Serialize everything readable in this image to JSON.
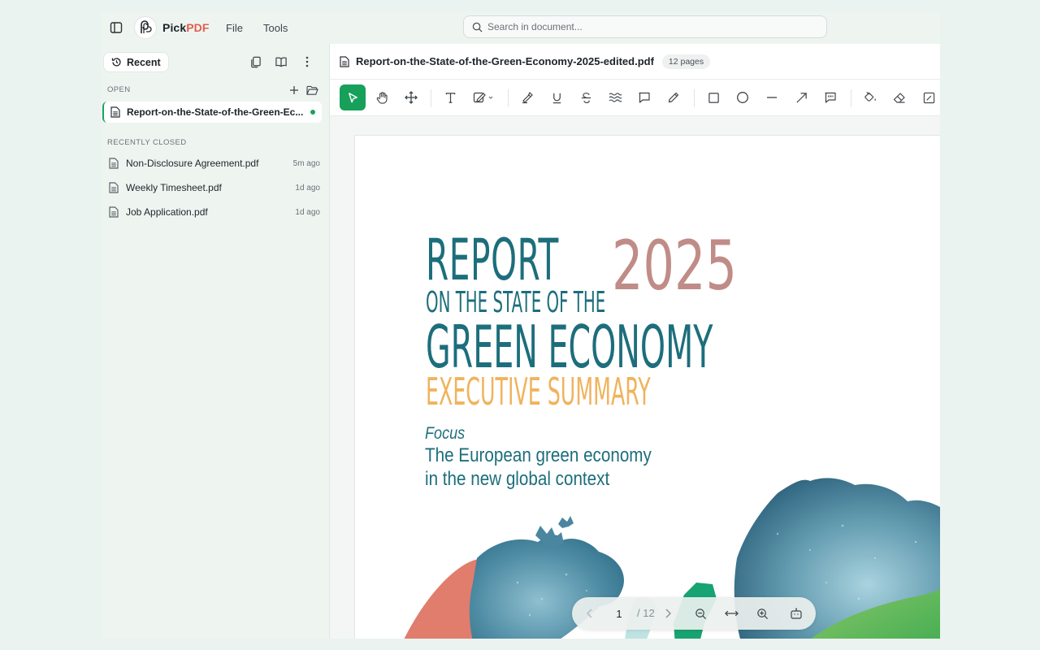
{
  "app": {
    "brand_part1": "Pick",
    "brand_part2": "PDF",
    "menu": [
      "File",
      "Tools"
    ],
    "accent": "#17a05a",
    "brand_color": "#e45d4f"
  },
  "search": {
    "placeholder": "Search in document..."
  },
  "sidebar": {
    "recent_label": "Recent",
    "open_section": "OPEN",
    "open_file": "Report-on-the-State-of-the-Green-Ec...",
    "closed_section": "RECENTLY CLOSED",
    "closed": [
      {
        "name": "Non-Disclosure Agreement.pdf",
        "time": "5m ago"
      },
      {
        "name": "Weekly Timesheet.pdf",
        "time": "1d ago"
      },
      {
        "name": "Job Application.pdf",
        "time": "1d ago"
      }
    ]
  },
  "document": {
    "title": "Report-on-the-State-of-the-Green-Economy-2025-edited.pdf",
    "pages_badge": "12 pages"
  },
  "toolbar": {
    "tools": [
      "select-tool",
      "hand-tool",
      "move-tool",
      "text-tool",
      "signature-tool",
      "highlight-tool",
      "underline-tool",
      "strikethrough-tool",
      "squiggly-tool",
      "comment-tool",
      "pencil-tool",
      "rectangle-tool",
      "ellipse-tool",
      "line-tool",
      "arrow-tool",
      "callout-tool",
      "fill-tool",
      "eraser-tool",
      "edit-tool"
    ]
  },
  "page_content": {
    "line1": "REPORT",
    "year": "2025",
    "line2": "ON THE STATE OF THE",
    "line3": "GREEN ECONOMY",
    "line4": "EXECUTIVE SUMMARY",
    "focus": "Focus",
    "sub1": "The European green economy",
    "sub2": "in the new global context"
  },
  "pager": {
    "current": "1",
    "total": "/ 12"
  }
}
